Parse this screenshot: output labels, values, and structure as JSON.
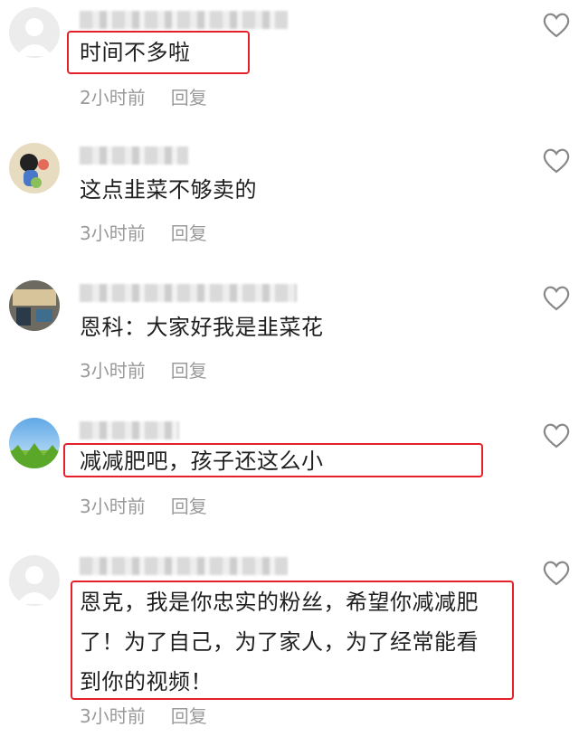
{
  "comments": [
    {
      "text": "时间不多啦",
      "time": "2小时前",
      "reply": "回复",
      "avatar": "default-avatar"
    },
    {
      "text": "这点韭菜不够卖的",
      "time": "3小时前",
      "reply": "回复",
      "avatar": "cartoon-avatar"
    },
    {
      "text": "恩科：大家好我是韭菜花",
      "time": "3小时前",
      "reply": "回复",
      "avatar": "room-photo-avatar"
    },
    {
      "text": "减减肥吧，孩子还这么小",
      "time": "3小时前",
      "reply": "回复",
      "avatar": "sky-grass-avatar"
    },
    {
      "text_lines": [
        "恩克，我是你忠实的粉丝，希望你减减肥",
        "了！为了自己，为了家人，为了经常能看",
        "到你的视频！"
      ],
      "time": "3小时前",
      "reply": "回复",
      "avatar": "default-avatar"
    }
  ],
  "colors": {
    "highlight": "#e5202a",
    "meta": "#9a9a9a",
    "text": "#1f1f1f"
  }
}
